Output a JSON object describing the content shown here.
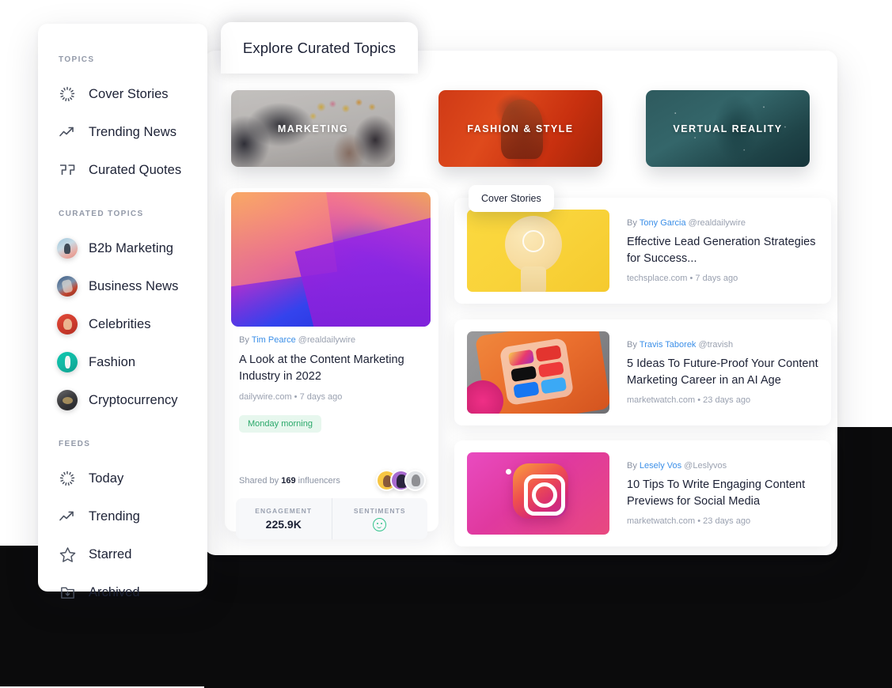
{
  "header": {
    "tab_title": "Explore Curated Topics"
  },
  "sidebar": {
    "sections": [
      {
        "label": "TOPICS",
        "items": [
          {
            "label": "Cover Stories",
            "icon": "sunburst-icon"
          },
          {
            "label": "Trending News",
            "icon": "trending-arrow-icon"
          },
          {
            "label": "Curated Quotes",
            "icon": "quote-marks-icon"
          }
        ]
      },
      {
        "label": "CURATED TOPICS",
        "items": [
          {
            "label": "B2b Marketing",
            "icon": "avatar-b2b-marketing"
          },
          {
            "label": "Business News",
            "icon": "avatar-business-news"
          },
          {
            "label": "Celebrities",
            "icon": "avatar-celebrities"
          },
          {
            "label": "Fashion",
            "icon": "avatar-fashion"
          },
          {
            "label": "Cryptocurrency",
            "icon": "avatar-cryptocurrency"
          }
        ]
      },
      {
        "label": "FEEDS",
        "items": [
          {
            "label": "Today",
            "icon": "sunburst-icon"
          },
          {
            "label": "Trending",
            "icon": "trending-arrow-icon"
          },
          {
            "label": "Starred",
            "icon": "star-icon"
          },
          {
            "label": "Archived",
            "icon": "archive-folder-icon"
          }
        ]
      }
    ]
  },
  "topic_cards": [
    {
      "label": "MARKETING",
      "image": "office-brainstorm-photo"
    },
    {
      "label": "FASHION & STYLE",
      "image": "red-fashion-portrait-photo"
    },
    {
      "label": "VERTUAL REALITY",
      "image": "vr-headset-teal-photo"
    }
  ],
  "tooltip": {
    "label": "Cover Stories"
  },
  "feature": {
    "image": "abstract-gradient-geometry",
    "by_prefix": "By",
    "author": "Tim Pearce",
    "handle": "@realdailywire",
    "title": "A Look at the Content Marketing Industry in 2022",
    "meta": "dailywire.com • 7 days ago",
    "badge": "Monday morning",
    "shared_prefix": "Shared by",
    "shared_count": "169",
    "shared_suffix": "influencers",
    "stats": [
      {
        "label": "ENGAGEMENT",
        "value": "225.9K",
        "type": "number"
      },
      {
        "label": "SENTIMENTS",
        "value": "",
        "type": "smiley-positive"
      }
    ]
  },
  "articles": [
    {
      "thumb": "yellow-lightbulb-photo",
      "by_prefix": "By",
      "author": "Tony Garcia",
      "handle": "@realdailywire",
      "title": "Effective Lead Generation Strategies for Success...",
      "meta": "techsplace.com • 7 days ago"
    },
    {
      "thumb": "phone-social-media-apps-photo",
      "by_prefix": "By",
      "author": "Travis Taborek",
      "handle": "@travish",
      "title": "5 Ideas To Future-Proof Your Content Marketing Career in an AI Age",
      "meta": "marketwatch.com • 23 days ago"
    },
    {
      "thumb": "instagram-3d-icon-photo",
      "by_prefix": "By",
      "author": "Lesely Vos",
      "handle": "@Leslyvos",
      "title": "10 Tips To Write Engaging Content Previews for Social Media",
      "meta": "marketwatch.com • 23 days ago"
    }
  ],
  "colors": {
    "accent_link": "#3b8fe8",
    "text_primary": "#1c2135",
    "text_muted": "#9aa1b0",
    "badge_bg": "#e7f7ee",
    "badge_text": "#2aa86a",
    "sentiment_positive": "#35c48e",
    "backdrop_dark": "#0b0b0c"
  }
}
